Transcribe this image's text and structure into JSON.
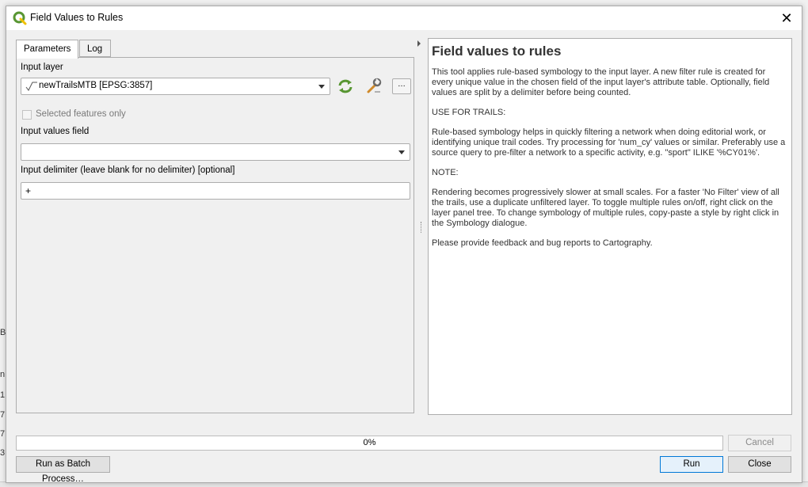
{
  "window": {
    "title": "Field Values to Rules"
  },
  "tabs": [
    {
      "label": "Parameters"
    },
    {
      "label": "Log"
    }
  ],
  "params": {
    "input_layer_label": "Input layer",
    "input_layer_value": "newTrailsMTB [EPSG:3857]",
    "selected_only_label": "Selected features only",
    "values_field_label": "Input values field",
    "values_field_value": "",
    "delimiter_label": "Input delimiter (leave blank for no delimiter) [optional]",
    "delimiter_value": "+",
    "more_button_label": "…"
  },
  "help": {
    "title": "Field values to rules",
    "paragraphs": [
      "This tool applies rule-based symbology to the input layer. A new filter rule is created for every unique value in the chosen field of the input layer's attribute table. Optionally, field values are split by a delimiter before being counted.",
      "USE FOR TRAILS:",
      "Rule-based symbology helps in quickly filtering a network when doing editorial work, or identifying unique trail codes. Try processing for 'num_cy' values or similar. Preferably use a source query to pre-filter a network to a specific activity, e.g. \"sport\" ILIKE '%CY01%'.",
      "NOTE:",
      "Rendering becomes progressively slower at small scales. For a faster 'No Filter' view of all the trails, use a duplicate unfiltered layer. To toggle multiple rules on/off, right click on the layer panel tree. To change symbology of multiple rules, copy-paste a style by right click in the Symbology dialogue.",
      "Please provide feedback and bug reports to Cartography."
    ]
  },
  "progress": {
    "value": 0,
    "label": "0%"
  },
  "buttons": {
    "cancel": "Cancel",
    "batch": "Run as Batch Process…",
    "run": "Run",
    "close": "Close"
  },
  "background": {
    "fragments": [
      "B",
      "n",
      "1",
      "7",
      "7",
      "3"
    ]
  },
  "colors": {
    "qgis_green": "#589632",
    "accent_blue": "#0078d7"
  }
}
